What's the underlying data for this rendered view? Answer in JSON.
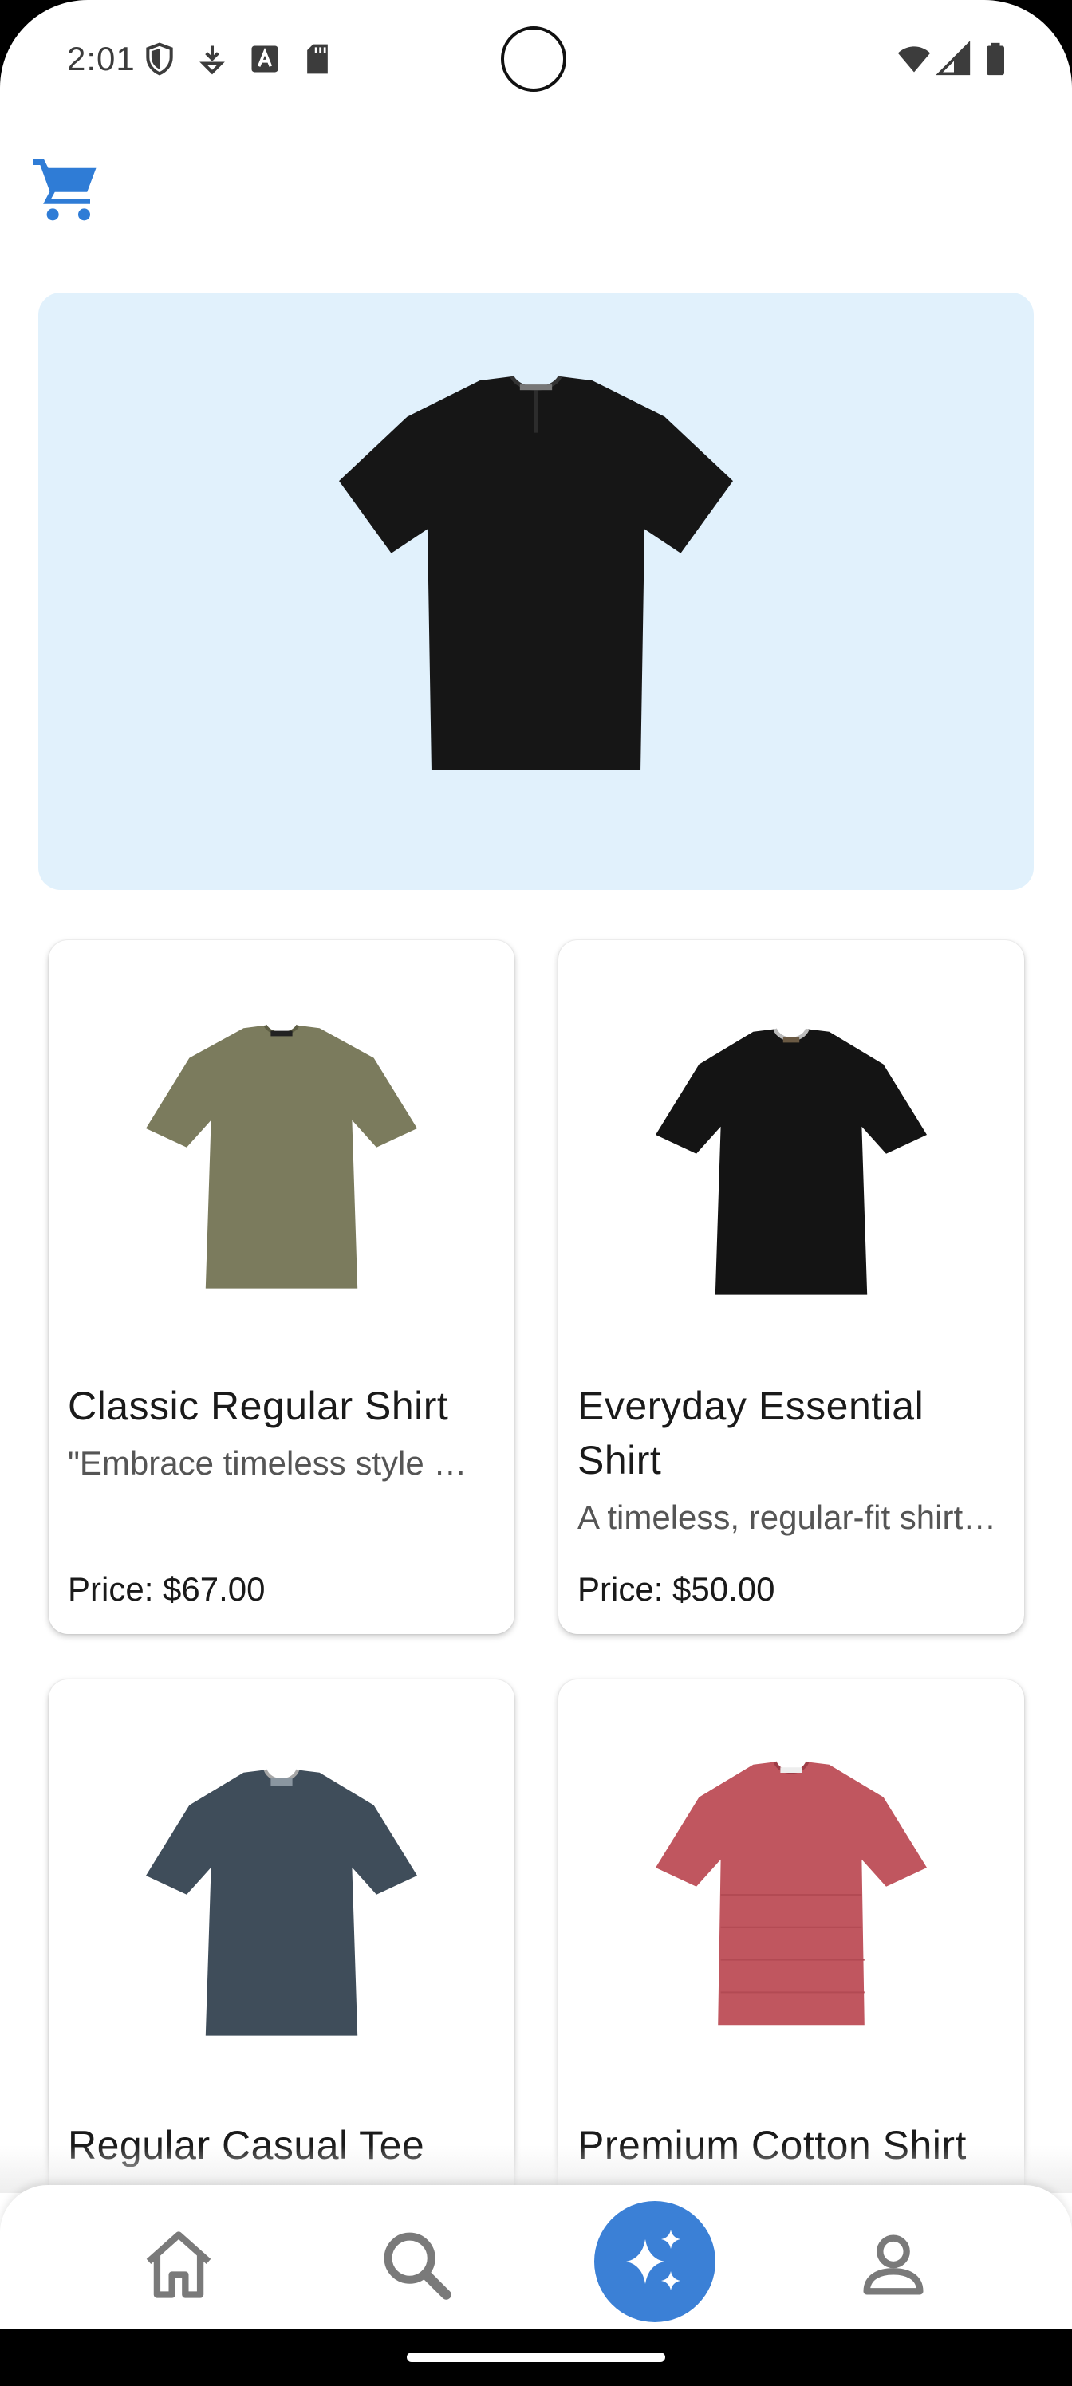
{
  "status_bar": {
    "time": "2:01",
    "icons": [
      "shield-icon",
      "download-icon",
      "font-icon",
      "sd-card-icon",
      "wifi-icon",
      "signal-icon",
      "battery-icon"
    ]
  },
  "header": {
    "cart_icon": "shopping-cart-icon",
    "accent_color": "#2f7cd6"
  },
  "hero": {
    "background_color": "#e1f1fc",
    "image": "black-henley-tshirt"
  },
  "products": [
    {
      "name": "Classic Regular Shirt",
      "description": "\"Embrace timeless style with our Classic Regular Shirt",
      "price": "Price: $67.00",
      "color": "#7a7a5c"
    },
    {
      "name": "Everyday Essential Shirt",
      "description": "A timeless, regular-fit shirt for everyday wear",
      "price": "Price: $50.00",
      "color": "#141414"
    },
    {
      "name": "Regular Casual Tee",
      "description": "",
      "price": "",
      "color": "#3f4d5a"
    },
    {
      "name": "Premium Cotton Shirt",
      "description": "",
      "price": "",
      "color": "#c0565f"
    }
  ],
  "bottom_nav": {
    "items": [
      "home-icon",
      "search-icon",
      "ai-sparkle-icon",
      "profile-icon"
    ],
    "active_color": "#3b80d6"
  }
}
